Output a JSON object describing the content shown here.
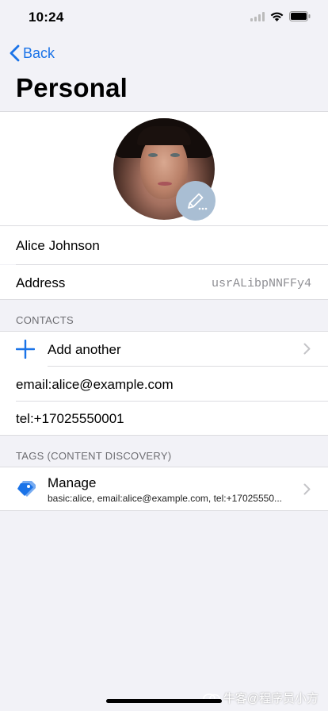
{
  "status_bar": {
    "time": "10:24"
  },
  "nav": {
    "back_label": "Back",
    "title": "Personal"
  },
  "profile": {
    "name": "Alice Johnson",
    "address_label": "Address",
    "address_value": "usrALibpNNFFy4"
  },
  "contacts": {
    "header": "CONTACTS",
    "add_label": "Add another",
    "items": [
      "email:alice@example.com",
      "tel:+17025550001"
    ]
  },
  "tags": {
    "header": "TAGS (CONTENT DISCOVERY)",
    "manage_label": "Manage",
    "manage_subtitle": "basic:alice, email:alice@example.com, tel:+17025550..."
  },
  "watermark": "牛客@程序员小方",
  "colors": {
    "accent": "#1a73e8",
    "background": "#f2f2f7",
    "edit_badge": "#a9bed3"
  },
  "icons": [
    "signal-icon",
    "wifi-icon",
    "battery-icon",
    "chevron-left-icon",
    "pencil-icon",
    "plus-icon",
    "chevron-right-icon",
    "tag-icon"
  ]
}
